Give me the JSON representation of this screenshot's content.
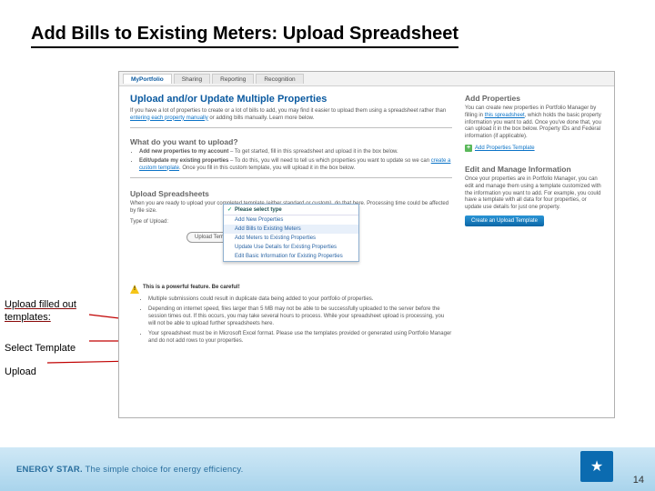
{
  "slide": {
    "title": "Add Bills to Existing Meters: Upload Spreadsheet",
    "number": "14",
    "notes": {
      "n1a": "Upload filled out",
      "n1b": "templates:",
      "n2": "Select Template",
      "n3": "Upload"
    }
  },
  "tabs": [
    "MyPortfolio",
    "Sharing",
    "Reporting",
    "Recognition"
  ],
  "header": {
    "title": "Upload and/or Update Multiple Properties",
    "intro_a": "If you have a lot of properties to create or a lot of bills to add, you may find it easier to upload them using a spreadsheet rather than ",
    "intro_link": "entering each property manually",
    "intro_b": " or adding bills manually. Learn more below."
  },
  "what": {
    "head": "What do you want to upload?",
    "li1_b": "Add new properties to my account",
    "li1_t": " – To get started, fill in this spreadsheet and upload it in the box below.",
    "li2_b": "Edit/update my existing properties",
    "li2_t": " – To do this, you will need to tell us which properties you want to update so we can ",
    "li2_link": "create a custom template",
    "li2_t2": ". Once you fill in this custom template, you will upload it in the box below."
  },
  "spread": {
    "head": "Upload Spreadsheets",
    "desc": "When you are ready to upload your completed template (either standard or custom), do that here. Processing time could be affected by file size.",
    "type_label": "Type of Upload:",
    "tpl_btn": "Upload Template",
    "dd_head": "Please select type",
    "dd_items": [
      "Add New Properties",
      "Add Bills to Existing Meters",
      "Add Meters to Existing Properties",
      "Update Use Details for Existing Properties",
      "Edit Basic Information for Existing Properties"
    ],
    "warn_head": "This is a powerful feature. Be careful!",
    "warn": [
      "Multiple submissions could result in duplicate data being added to your portfolio of properties.",
      "Depending on internet speed, files larger than 5 MB may not be able to be successfully uploaded to the server before the session times out. If this occurs, you may take several hours to process. While your spreadsheet upload is processing, you will not be able to upload further spreadsheets here.",
      "Your spreadsheet must be in Microsoft Excel format. Please use the templates provided or generated using Portfolio Manager and do not add rows to your properties."
    ]
  },
  "side_add": {
    "head": "Add Properties",
    "body_a": "You can create new properties in Portfolio Manager by filling in ",
    "body_link": "this spreadsheet",
    "body_b": ", which holds the basic property information you want to add. Once you've done that, you can upload it in the box below. Property IDs and Federal information (if applicable).",
    "link": "Add Properties Template"
  },
  "side_edit": {
    "head": "Edit and Manage Information",
    "body": "Once your properties are in Portfolio Manager, you can edit and manage them using a template customized with the information you want to add. For example, you could have a template with all data for four properties, or update use details for just one property.",
    "btn": "Create an Upload Template"
  },
  "footer": {
    "brand": "ENERGY STAR.",
    "tag": " The simple choice for energy efficiency."
  }
}
